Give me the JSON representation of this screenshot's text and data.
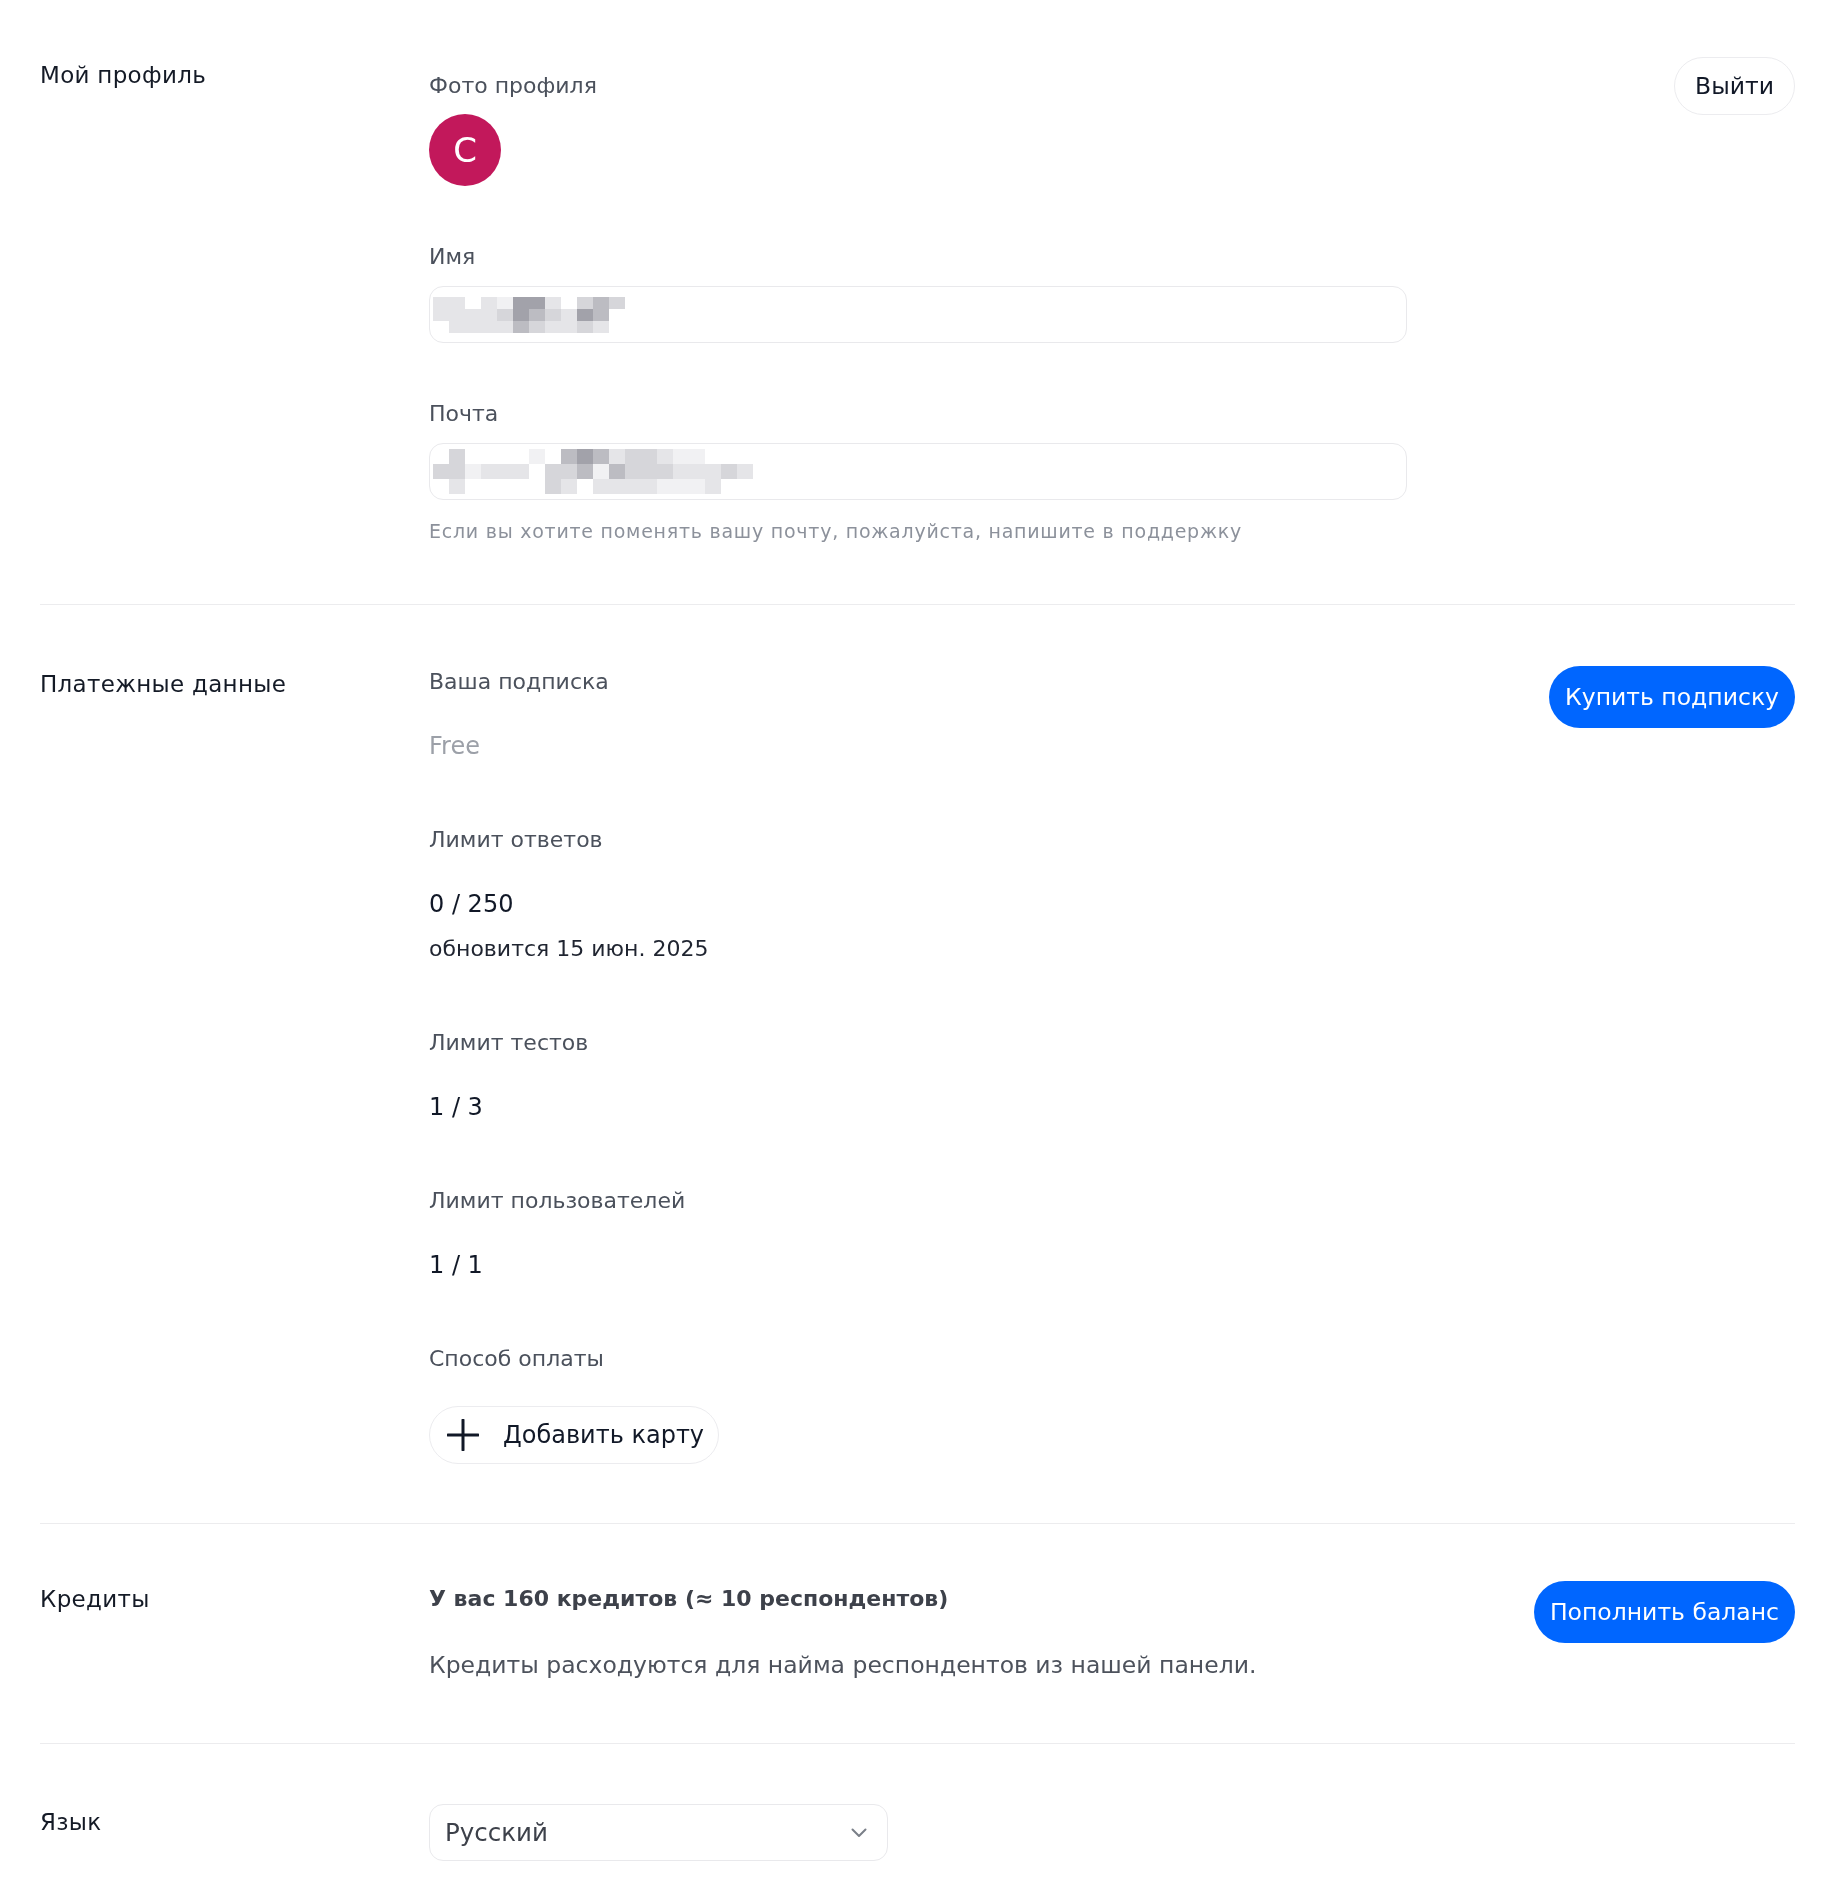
{
  "sections": [
    {
      "kind": "profile",
      "title": "Мой профиль",
      "action": {
        "label": "Выйти"
      },
      "photo": {
        "label": "Фото профиля",
        "initial": "C"
      },
      "fields": [
        {
          "label": "Имя",
          "redacted": true
        },
        {
          "label": "Почта",
          "redacted": true,
          "note": "Если вы хотите поменять вашу почту, пожалуйста, напишите в поддержку"
        }
      ]
    },
    {
      "kind": "billing",
      "title": "Платежные данные",
      "action": {
        "label": "Купить подписку"
      },
      "items": [
        {
          "kind": "plan",
          "label": "Ваша подписка",
          "value": "Free"
        },
        {
          "kind": "limit",
          "label": "Лимит ответов",
          "value": "0 / 250",
          "note": "обновится 15 июн. 2025"
        },
        {
          "kind": "limit",
          "label": "Лимит тестов",
          "value": "1 / 3"
        },
        {
          "kind": "limit",
          "label": "Лимит пользователей",
          "value": "1 / 1"
        },
        {
          "kind": "payment",
          "label": "Способ оплаты",
          "button": "Добавить карту"
        }
      ]
    },
    {
      "kind": "credits",
      "title": "Кредиты",
      "action": {
        "label": "Пополнить баланс"
      },
      "summary": "У вас 160 кредитов (≈ 10 респондентов)",
      "description": "Кредиты расходуются для найма респондентов из нашей панели."
    },
    {
      "kind": "language",
      "title": "Язык",
      "select": {
        "value": "Русский"
      }
    }
  ]
}
